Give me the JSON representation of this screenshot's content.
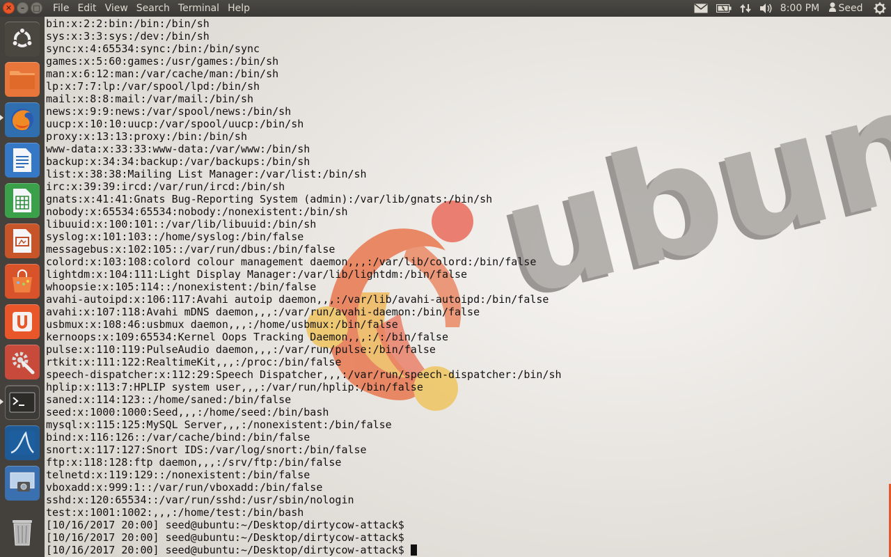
{
  "menu": {
    "file": "File",
    "edit": "Edit",
    "view": "View",
    "search": "Search",
    "terminal": "Terminal",
    "help": "Help"
  },
  "indicators": {
    "mail_icon": "mail-icon",
    "battery_icon": "battery-icon",
    "network_icon": "network-icon",
    "sound_icon": "volume-icon",
    "clock": "8:00 PM",
    "user": "Seed",
    "settings_icon": "gear-icon"
  },
  "launcher": {
    "items": [
      {
        "name": "dash-home",
        "icon": "ubuntu-logo-icon"
      },
      {
        "name": "files",
        "icon": "folder-icon"
      },
      {
        "name": "firefox",
        "icon": "firefox-icon"
      },
      {
        "name": "writer",
        "icon": "document-icon"
      },
      {
        "name": "calc",
        "icon": "spreadsheet-icon"
      },
      {
        "name": "impress",
        "icon": "presentation-icon"
      },
      {
        "name": "software-center",
        "icon": "shopping-bag-icon"
      },
      {
        "name": "ubuntu-one",
        "icon": "ubuntu-one-icon"
      },
      {
        "name": "system-settings",
        "icon": "settings-wrench-icon"
      },
      {
        "name": "terminal",
        "icon": "terminal-icon"
      },
      {
        "name": "wireshark",
        "icon": "wireshark-fin-icon"
      },
      {
        "name": "screenshot",
        "icon": "camera-monitor-icon"
      },
      {
        "name": "trash",
        "icon": "trash-icon"
      }
    ]
  },
  "wallpaper_text": "ubun",
  "colors": {
    "panel": "#3c3b37",
    "accent": "#e8562a",
    "text": "#111111"
  },
  "terminal": {
    "lines": [
      "bin:x:2:2:bin:/bin:/bin/sh",
      "sys:x:3:3:sys:/dev:/bin/sh",
      "sync:x:4:65534:sync:/bin:/bin/sync",
      "games:x:5:60:games:/usr/games:/bin/sh",
      "man:x:6:12:man:/var/cache/man:/bin/sh",
      "lp:x:7:7:lp:/var/spool/lpd:/bin/sh",
      "mail:x:8:8:mail:/var/mail:/bin/sh",
      "news:x:9:9:news:/var/spool/news:/bin/sh",
      "uucp:x:10:10:uucp:/var/spool/uucp:/bin/sh",
      "proxy:x:13:13:proxy:/bin:/bin/sh",
      "www-data:x:33:33:www-data:/var/www:/bin/sh",
      "backup:x:34:34:backup:/var/backups:/bin/sh",
      "list:x:38:38:Mailing List Manager:/var/list:/bin/sh",
      "irc:x:39:39:ircd:/var/run/ircd:/bin/sh",
      "gnats:x:41:41:Gnats Bug-Reporting System (admin):/var/lib/gnats:/bin/sh",
      "nobody:x:65534:65534:nobody:/nonexistent:/bin/sh",
      "libuuid:x:100:101::/var/lib/libuuid:/bin/sh",
      "syslog:x:101:103::/home/syslog:/bin/false",
      "messagebus:x:102:105::/var/run/dbus:/bin/false",
      "colord:x:103:108:colord colour management daemon,,,:/var/lib/colord:/bin/false",
      "lightdm:x:104:111:Light Display Manager:/var/lib/lightdm:/bin/false",
      "whoopsie:x:105:114::/nonexistent:/bin/false",
      "avahi-autoipd:x:106:117:Avahi autoip daemon,,,:/var/lib/avahi-autoipd:/bin/false",
      "avahi:x:107:118:Avahi mDNS daemon,,,:/var/run/avahi-daemon:/bin/false",
      "usbmux:x:108:46:usbmux daemon,,,:/home/usbmux:/bin/false",
      "kernoops:x:109:65534:Kernel Oops Tracking Daemon,,,:/:/bin/false",
      "pulse:x:110:119:PulseAudio daemon,,,:/var/run/pulse:/bin/false",
      "rtkit:x:111:122:RealtimeKit,,,:/proc:/bin/false",
      "speech-dispatcher:x:112:29:Speech Dispatcher,,,:/var/run/speech-dispatcher:/bin/sh",
      "hplip:x:113:7:HPLIP system user,,,:/var/run/hplip:/bin/false",
      "saned:x:114:123::/home/saned:/bin/false",
      "seed:x:1000:1000:Seed,,,:/home/seed:/bin/bash",
      "mysql:x:115:125:MySQL Server,,,:/nonexistent:/bin/false",
      "bind:x:116:126::/var/cache/bind:/bin/false",
      "snort:x:117:127:Snort IDS:/var/log/snort:/bin/false",
      "ftp:x:118:128:ftp daemon,,,:/srv/ftp:/bin/false",
      "telnetd:x:119:129::/nonexistent:/bin/false",
      "vboxadd:x:999:1::/var/run/vboxadd:/bin/false",
      "sshd:x:120:65534::/var/run/sshd:/usr/sbin/nologin",
      "test:x:1001:1002:,,,:/home/test:/bin/bash",
      "[10/16/2017 20:00] seed@ubuntu:~/Desktop/dirtycow-attack$",
      "[10/16/2017 20:00] seed@ubuntu:~/Desktop/dirtycow-attack$"
    ],
    "prompt": "[10/16/2017 20:00] seed@ubuntu:~/Desktop/dirtycow-attack$ "
  }
}
